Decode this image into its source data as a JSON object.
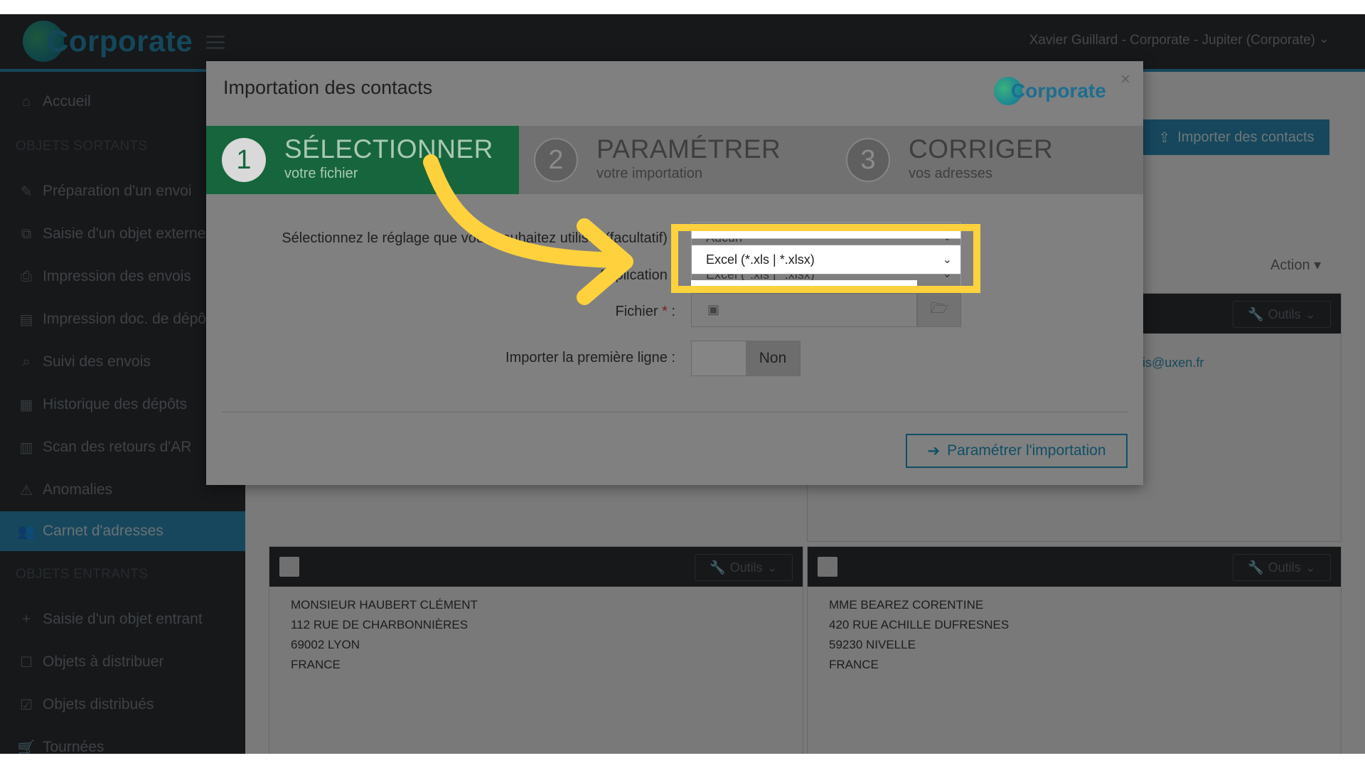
{
  "topbar": {
    "logo_text": "Corporate",
    "user_menu": "Xavier Guillard - Corporate - Jupiter (Corporate)"
  },
  "sidebar": {
    "items": [
      {
        "label": "Accueil",
        "icon": "home-icon"
      },
      {
        "label": "Préparation d'un envoi",
        "icon": "pencil-icon"
      },
      {
        "label": "Saisie d'un objet externe",
        "icon": "external-edit-icon"
      },
      {
        "label": "Impression des envois",
        "icon": "printer-icon"
      },
      {
        "label": "Impression doc. de dépôt",
        "icon": "document-icon"
      },
      {
        "label": "Suivi des envois",
        "icon": "search-icon"
      },
      {
        "label": "Historique des dépôts",
        "icon": "calendar-icon"
      },
      {
        "label": "Scan des retours d'AR",
        "icon": "barcode-icon"
      },
      {
        "label": "Anomalies",
        "icon": "warning-icon"
      },
      {
        "label": "Carnet d'adresses",
        "icon": "users-icon"
      },
      {
        "label": "Saisie d'un objet entrant",
        "icon": "plus-icon"
      },
      {
        "label": "Objets à distribuer",
        "icon": "checkbox-empty-icon"
      },
      {
        "label": "Objets distribués",
        "icon": "checkbox-checked-icon"
      },
      {
        "label": "Tournées",
        "icon": "cart-icon"
      }
    ],
    "sections": {
      "outgoing": "OBJETS SORTANTS",
      "incoming": "OBJETS ENTRANTS"
    }
  },
  "page": {
    "import_button": "Importer des contacts",
    "action_label": "Action",
    "tools_label": "Outils",
    "email_fragment": "ois@uxen.fr",
    "contacts": [
      {
        "name": "MONSIEUR HAUBERT CLÉMENT",
        "street": "112 RUE DE CHARBONNIÈRES",
        "city": "69002 LYON",
        "country": "FRANCE"
      },
      {
        "name": "MME BEAREZ CORENTINE",
        "street": "420 RUE ACHILLE DUFRESNES",
        "city": "59230 NIVELLE",
        "country": "FRANCE"
      }
    ]
  },
  "modal": {
    "title": "Importation des contacts",
    "logo_text": "Corporate",
    "close": "×",
    "steps": [
      {
        "number": "1",
        "title": "SÉLECTIONNER",
        "subtitle": "votre fichier"
      },
      {
        "number": "2",
        "title": "PARAMÉTRER",
        "subtitle": "votre importation"
      },
      {
        "number": "3",
        "title": "CORRIGER",
        "subtitle": "vos adresses"
      }
    ],
    "fields": {
      "setting_label": "Sélectionnez le réglage que vous souhaitez utiliser (facultatif) :",
      "setting_value": "Aucun",
      "application_label": "Application :",
      "application_value": "Excel (*.xls | *.xlsx)",
      "file_label": "Fichier",
      "file_required": "*",
      "file_colon": ":",
      "first_line_label": "Importer la première ligne :",
      "first_line_value": "Non"
    },
    "next_button": "Paramétrer l'importation"
  },
  "colors": {
    "accent": "#2e8fb8",
    "step_active": "#17653c",
    "highlight": "#ffd23d"
  }
}
